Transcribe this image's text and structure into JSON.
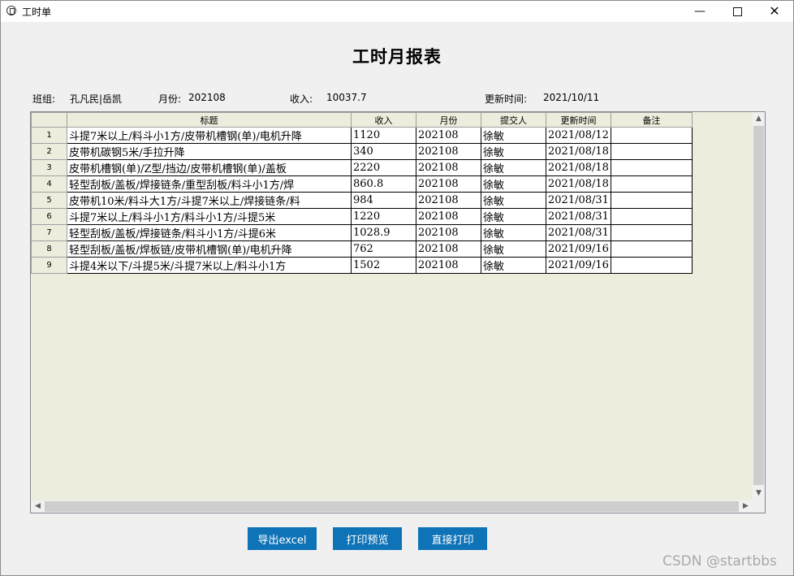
{
  "window": {
    "title": "工时单"
  },
  "report": {
    "title": "工时月报表"
  },
  "info": {
    "team_label": "班组:",
    "team_value": "孔凡民|岳凯",
    "month_label": "月份:",
    "month_value": "202108",
    "income_label": "收入:",
    "income_value": "10037.7",
    "updated_label": "更新时间:",
    "updated_value": "2021/10/11"
  },
  "grid": {
    "columns": [
      "标题",
      "收入",
      "月份",
      "提交人",
      "更新时间",
      "备注"
    ],
    "rows": [
      {
        "n": "1",
        "title": "斗提7米以上/料斗小1方/皮带机槽钢(单)/电机升降",
        "income": "1120",
        "month": "202108",
        "submitter": "徐敏",
        "updated": "2021/08/12",
        "note": ""
      },
      {
        "n": "2",
        "title": "皮带机碳钢5米/手拉升降",
        "income": "340",
        "month": "202108",
        "submitter": "徐敏",
        "updated": "2021/08/18",
        "note": ""
      },
      {
        "n": "3",
        "title": "皮带机槽钢(单)/Z型/挡边/皮带机槽钢(单)/盖板",
        "income": "2220",
        "month": "202108",
        "submitter": "徐敏",
        "updated": "2021/08/18",
        "note": ""
      },
      {
        "n": "4",
        "title": "轻型刮板/盖板/焊接链条/重型刮板/料斗小1方/焊",
        "income": "860.8",
        "month": "202108",
        "submitter": "徐敏",
        "updated": "2021/08/18",
        "note": ""
      },
      {
        "n": "5",
        "title": "皮带机10米/料斗大1方/斗提7米以上/焊接链条/料",
        "income": "984",
        "month": "202108",
        "submitter": "徐敏",
        "updated": "2021/08/31",
        "note": ""
      },
      {
        "n": "6",
        "title": "斗提7米以上/料斗小1方/料斗小1方/斗提5米",
        "income": "1220",
        "month": "202108",
        "submitter": "徐敏",
        "updated": "2021/08/31",
        "note": ""
      },
      {
        "n": "7",
        "title": "轻型刮板/盖板/焊接链条/料斗小1方/斗提6米",
        "income": "1028.9",
        "month": "202108",
        "submitter": "徐敏",
        "updated": "2021/08/31",
        "note": ""
      },
      {
        "n": "8",
        "title": "轻型刮板/盖板/焊板链/皮带机槽钢(单)/电机升降",
        "income": "762",
        "month": "202108",
        "submitter": "徐敏",
        "updated": "2021/09/16",
        "note": ""
      },
      {
        "n": "9",
        "title": "斗提4米以下/斗提5米/斗提7米以上/料斗小1方",
        "income": "1502",
        "month": "202108",
        "submitter": "徐敏",
        "updated": "2021/09/16",
        "note": ""
      }
    ]
  },
  "buttons": {
    "export": "导出excel",
    "preview": "打印预览",
    "print": "直接打印"
  },
  "watermark": "CSDN @startbbs",
  "icons": {
    "app": "app-icon",
    "minimize": "minimize-icon",
    "maximize": "maximize-icon",
    "close": "close-icon"
  },
  "colors": {
    "button_bg": "#0f73b8",
    "grid_bg": "#ededde"
  }
}
